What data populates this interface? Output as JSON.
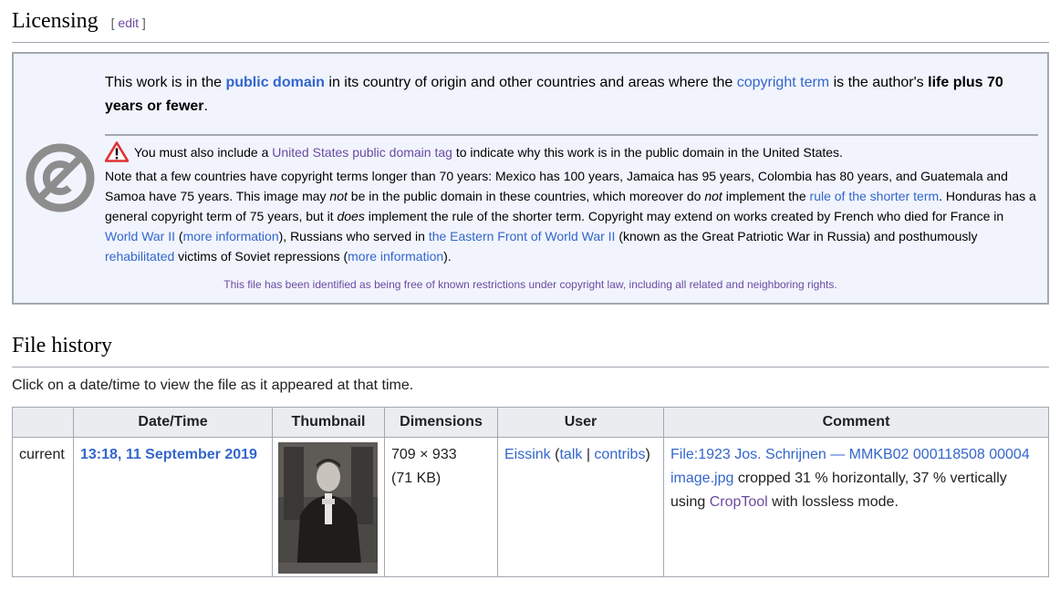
{
  "licensing": {
    "title": "Licensing",
    "edit_open": "[ ",
    "edit_label": "edit",
    "edit_close": " ]"
  },
  "pd": {
    "main_1": "This work is in the ",
    "main_link_1": "public domain",
    "main_2": " in its country of origin and other countries and areas where the ",
    "main_link_2": "copyright term",
    "main_3": " is the author's ",
    "main_bold": "life plus 70 years or fewer",
    "main_4": ".",
    "warn_1": "You must also include a ",
    "warn_link": "United States public domain tag",
    "warn_2": " to indicate why this work is in the public domain in the United States.",
    "note_1": " Note that a few countries have copyright terms longer than 70 years: Mexico has 100 years, Jamaica has 95 years, Colombia has 80 years, and Guatemala and Samoa have 75 years. This image may ",
    "note_em_1": "not",
    "note_2": " be in the public domain in these countries, which moreover do ",
    "note_em_2": "not",
    "note_3": " implement the ",
    "note_link_1": "rule of the shorter term",
    "note_4": ". Honduras has a general copyright term of 75 years, but it ",
    "note_em_3": "does",
    "note_5": " implement the rule of the shorter term. Copyright may extend on works created by French who died for France in ",
    "note_link_2": "World War II",
    "note_6": " (",
    "note_link_3": "more information",
    "note_7": "), Russians who served in ",
    "note_link_4": "the Eastern Front of World War II",
    "note_8": " (known as the Great Patriotic War in Russia) and posthumously ",
    "note_link_5": "rehabilitated",
    "note_9": " victims of Soviet repressions (",
    "note_link_6": "more information",
    "note_10": ").",
    "footer": "This file has been identified as being free of known restrictions under copyright law, including all related and neighboring rights."
  },
  "file_history": {
    "title": "File history",
    "intro": "Click on a date/time to view the file as it appeared at that time.",
    "headers": [
      "",
      "Date/Time",
      "Thumbnail",
      "Dimensions",
      "User",
      "Comment"
    ],
    "row": {
      "status": "current",
      "datetime": "13:18, 11 September 2019",
      "dimensions": "709 × 933",
      "size": "(71 KB)",
      "user": "Eissink",
      "user_open": " (",
      "talk": "talk",
      "sep": " | ",
      "contribs": "contribs",
      "user_close": ")",
      "comment_link": "File:1923 Jos. Schrijnen — MMKB02 000118508 00004 image.jpg",
      "comment_1": " cropped 31 % horizontally, 37 % vertically using ",
      "comment_tool": "CropTool",
      "comment_2": " with lossless mode."
    }
  },
  "colors": {
    "link": "#3366cc",
    "visited": "#6b4ba1",
    "box_bg": "#f1f4fd",
    "border": "#a2a9b1",
    "header_bg": "#eaecf0"
  },
  "icons": {
    "pd": "public-domain-icon",
    "warning": "warning-icon"
  }
}
